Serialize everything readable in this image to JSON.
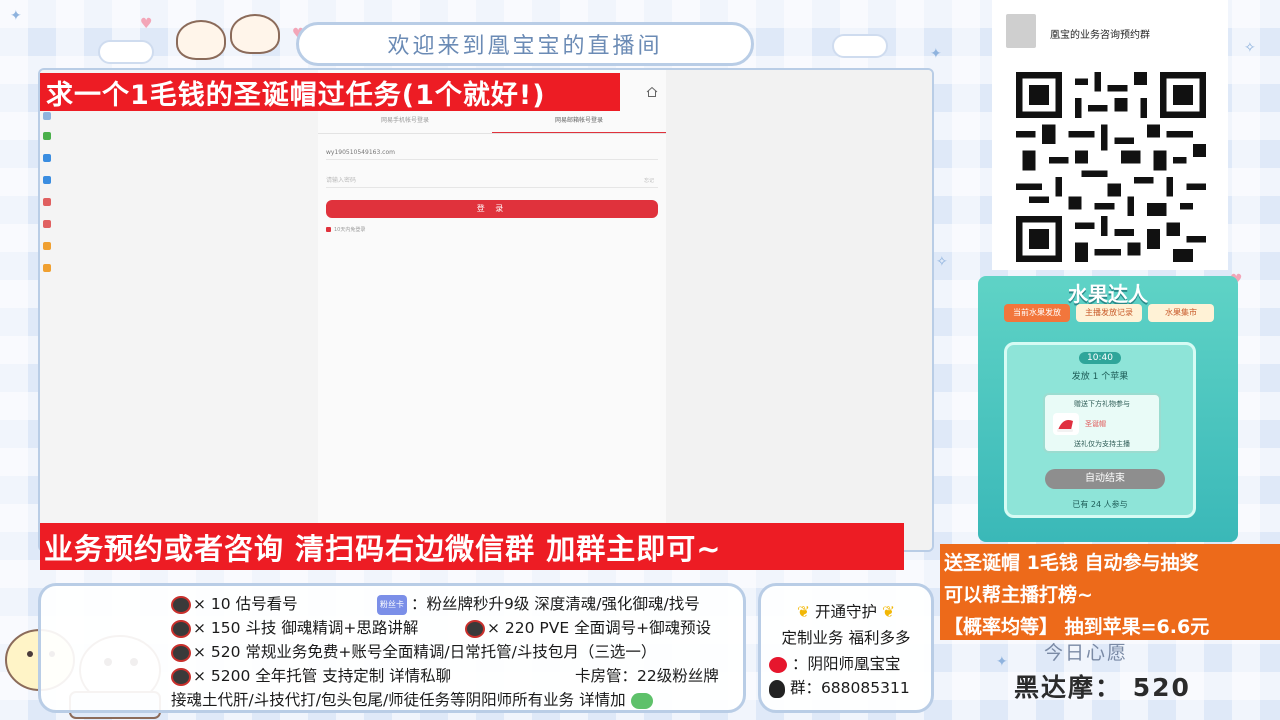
{
  "header": {
    "welcome": "欢迎来到凰宝宝的直播间"
  },
  "browser": {
    "tabs": [
      "网易手机帐号登录",
      "网易邮箱帐号登录"
    ],
    "account_value": "wy190510549163.com",
    "password_placeholder": "请输入密码",
    "password_hint": "忘记",
    "login_button": "登 录",
    "remember_label": "10天内免登录"
  },
  "banners": {
    "task_request": "求一个1毛钱的圣诞帽过任务(1个就好!)",
    "consult": "业务预约或者咨询 清扫码右边微信群 加群主即可~"
  },
  "services": {
    "lines": [
      {
        "prefix": "× 10 估号看号",
        "suffix": "：粉丝牌秒升9级 深度清魂/强化御魂/找号",
        "card_label": "粉丝卡"
      },
      {
        "prefix": "× 150  斗技 御魂精调+思路讲解",
        "suffix": "× 220  PVE 全面调号+御魂预设"
      },
      {
        "prefix": "× 520  常规业务免费+账号全面精调/日常托管/斗技包月（三选一）"
      },
      {
        "prefix": "× 5200 全年托管 支持定制 详情私聊",
        "suffix": "卡房管：22级粉丝牌"
      },
      {
        "prefix": "接魂土代肝/斗技代打/包头包尾/师徒任务等阴阳师所有业务 详情加"
      }
    ]
  },
  "guard": {
    "title": "开通守护",
    "subtitle": "定制业务 福利多多",
    "weibo": "：阴阳师凰宝宝",
    "qq_group": "群：688085311"
  },
  "wechat": {
    "group_name": "凰宝的业务咨询预约群"
  },
  "fruit": {
    "title": "水果达人",
    "tabs": [
      "当前水果发放",
      "主播发放记录",
      "水果集市"
    ],
    "time": "10:40",
    "drop_text": "发放 1 个苹果",
    "gift_instruction": "赠送下方礼物参与",
    "gift_name": "圣诞帽",
    "gift_note": "送礼仅为支持主播",
    "auto_button": "自动结束",
    "participants": "已有 24 人参与"
  },
  "orange_banner": {
    "line1": "送圣诞帽 1毛钱 自动参与抽奖",
    "line2": "可以帮主播打榜~",
    "line3": "【概率均等】 抽到苹果=6.6元"
  },
  "wish": {
    "title": "今日心愿",
    "value": "黑达摩： 520"
  },
  "colors": {
    "red_banner": "#ed1c24",
    "orange_banner": "#ed6a1a",
    "frame_border": "#b9cde6",
    "login_red": "#e0323c",
    "fruit_teal": "#5fd3c6"
  }
}
